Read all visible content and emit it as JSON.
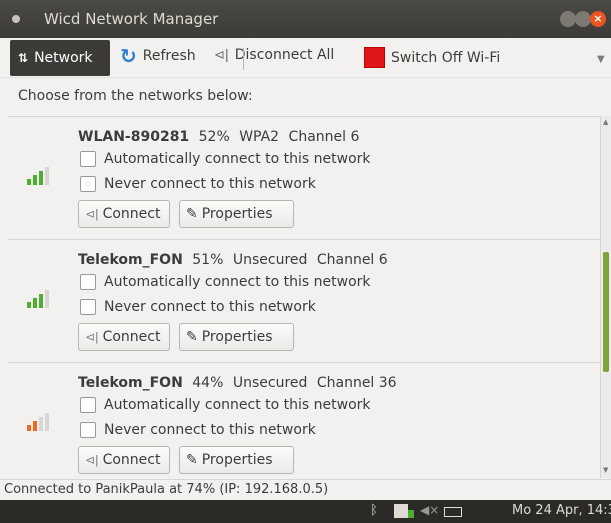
{
  "window": {
    "title": "Wicd Network Manager"
  },
  "toolbar": {
    "network_label": "Network",
    "refresh_label": "Refresh",
    "disconnect_label": "Disconnect All",
    "wifi_off_label": "Switch Off Wi-Fi"
  },
  "prompt": "Choose from the networks below:",
  "networks": [
    {
      "essid": "WLAN-890281",
      "strength": "52%",
      "security": "WPA2",
      "channel": "Channel 6",
      "auto_label": "Automatically connect to this network",
      "never_label": "Never connect to this network",
      "connect_label": "Connect",
      "properties_label": "Properties",
      "signal_bars": 3,
      "signal_color": "#4caf32"
    },
    {
      "essid": "Telekom_FON",
      "strength": "51%",
      "security": "Unsecured",
      "channel": "Channel 6",
      "auto_label": "Automatically connect to this network",
      "never_label": "Never connect to this network",
      "connect_label": "Connect",
      "properties_label": "Properties",
      "signal_bars": 3,
      "signal_color": "#4caf32"
    },
    {
      "essid": "Telekom_FON",
      "strength": "44%",
      "security": "Unsecured",
      "channel": "Channel 36",
      "auto_label": "Automatically connect to this network",
      "never_label": "Never connect to this network",
      "connect_label": "Connect",
      "properties_label": "Properties",
      "signal_bars": 2,
      "signal_color": "#f06a1f"
    }
  ],
  "status": "Connected to PanikPaula at 74% (IP: 192.168.0.5)",
  "panel": {
    "clock": "Mo 24 Apr, 14:3"
  },
  "colors": {
    "accent_close": "#e95420",
    "wifi_off": "#e0161b",
    "signal_good": "#4caf32",
    "signal_weak": "#f06a1f"
  },
  "icons": {
    "refresh": "refresh-icon",
    "disconnect": "plug-icon",
    "wifi_off": "red-square-icon",
    "connect": "plug-icon",
    "properties": "pencil-icon"
  }
}
